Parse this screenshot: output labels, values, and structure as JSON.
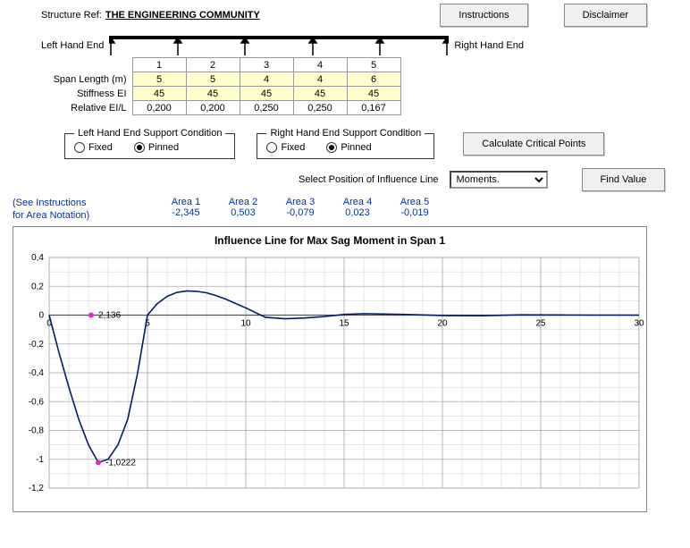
{
  "header": {
    "structure_ref_label": "Structure Ref:",
    "structure_ref_value": "THE ENGINEERING COMMUNITY",
    "instructions_btn": "Instructions",
    "disclaimer_btn": "Disclaimer"
  },
  "beam": {
    "left_end": "Left Hand End",
    "right_end": "Right Hand End",
    "span_headers": [
      "1",
      "2",
      "3",
      "4",
      "5"
    ],
    "rows": {
      "span_length": {
        "label": "Span Length (m)",
        "values": [
          "5",
          "5",
          "4",
          "4",
          "6"
        ]
      },
      "stiffness": {
        "label": "Stiffness EI",
        "values": [
          "45",
          "45",
          "45",
          "45",
          "45"
        ]
      },
      "rel_eil": {
        "label": "Relative EI/L",
        "values": [
          "0,200",
          "0,200",
          "0,250",
          "0,250",
          "0,167"
        ]
      }
    }
  },
  "supports": {
    "left": {
      "legend": "Left Hand End Support Condition",
      "fixed": "Fixed",
      "pinned": "Pinned",
      "selected": "pinned"
    },
    "right": {
      "legend": "Right Hand End Support Condition",
      "fixed": "Fixed",
      "pinned": "Pinned",
      "selected": "pinned"
    },
    "calc_btn": "Calculate Critical Points"
  },
  "influence": {
    "label": "Select Position of Influence Line",
    "selected": "Moments.",
    "find_btn": "Find Value"
  },
  "areas": {
    "note1": "(See Instructions",
    "note2": "for Area Notation)",
    "cols": [
      {
        "name": "Area 1",
        "val": "-2,345"
      },
      {
        "name": "Area 2",
        "val": "0,503"
      },
      {
        "name": "Area 3",
        "val": "-0,079"
      },
      {
        "name": "Area 4",
        "val": "0,023"
      },
      {
        "name": "Area 5",
        "val": "-0,019"
      }
    ]
  },
  "chart_data": {
    "type": "line",
    "title": "Influence Line for Max Sag Moment in Span 1",
    "xlabel": "",
    "ylabel": "",
    "xlim": [
      0,
      30
    ],
    "ylim": [
      -1.2,
      0.4
    ],
    "xticks": [
      0,
      5,
      10,
      15,
      20,
      25,
      30
    ],
    "yticks": [
      0.4,
      0.2,
      0,
      -0.2,
      -0.4,
      -0.6,
      -0.8,
      -1,
      -1.2
    ],
    "series": [
      {
        "name": "influence",
        "x": [
          0,
          0.5,
          1,
          1.5,
          2,
          2.5,
          3,
          3.5,
          4,
          4.5,
          5,
          5.5,
          6,
          6.5,
          7,
          7.5,
          8,
          8.5,
          9,
          9.5,
          10,
          11,
          12,
          13,
          14,
          15,
          16,
          18,
          20,
          22,
          24,
          26,
          28,
          30
        ],
        "y": [
          0,
          -0.26,
          -0.5,
          -0.72,
          -0.9,
          -1.0222,
          -1.0,
          -0.9,
          -0.72,
          -0.4,
          0,
          0.08,
          0.13,
          0.158,
          0.168,
          0.165,
          0.155,
          0.135,
          0.11,
          0.08,
          0.05,
          -0.015,
          -0.025,
          -0.02,
          -0.01,
          0.005,
          0.01,
          0.005,
          -0.003,
          -0.004,
          0.002,
          0.001,
          0,
          0
        ]
      }
    ],
    "markers": [
      {
        "x": 2.5,
        "y": -1.0222,
        "label": "-1,0222"
      },
      {
        "x": 2.136,
        "y": 0,
        "label": "2,136"
      }
    ]
  }
}
